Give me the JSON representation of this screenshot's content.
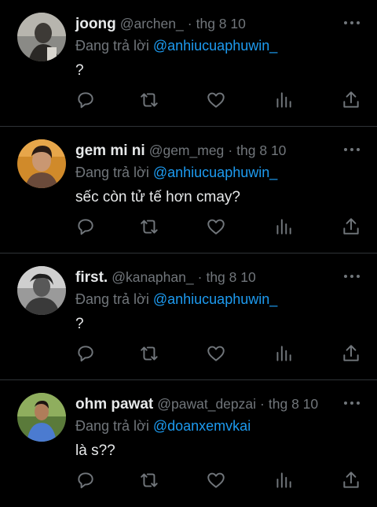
{
  "reply_prefix": "Đang trả lời",
  "separator": "·",
  "tweets": [
    {
      "name": "joong",
      "handle": "@archen_",
      "time": "thg 8 10",
      "reply_to": "@anhiucuaphuwin_",
      "text": "?"
    },
    {
      "name": "gem mi ni",
      "handle": "@gem_meg",
      "time": "thg 8 10",
      "reply_to": "@anhiucuaphuwin_",
      "text": "sếc còn tử tế hơn cmay?"
    },
    {
      "name": "first.",
      "handle": "@kanaphan_",
      "time": "thg 8 10",
      "reply_to": "@anhiucuaphuwin_",
      "text": "?"
    },
    {
      "name": "ohm pawat",
      "handle": "@pawat_depzai",
      "time": "thg 8 10",
      "reply_to": "@doanxemvkai",
      "text": "là s??"
    }
  ],
  "icons": {
    "reply": "reply-icon",
    "retweet": "retweet-icon",
    "like": "like-icon",
    "views": "views-icon",
    "share": "share-icon",
    "more": "more-icon"
  },
  "colors": {
    "background": "#000000",
    "text": "#e7e9ea",
    "muted": "#71767b",
    "link": "#1d9bf0",
    "divider": "#2f3336"
  }
}
